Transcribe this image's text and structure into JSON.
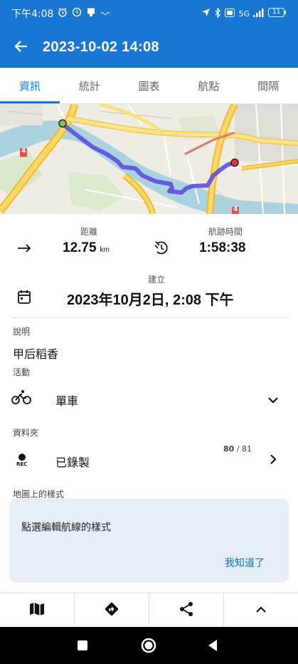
{
  "status_bar": {
    "time": "下午4:08",
    "right_text": "5G",
    "battery": "11"
  },
  "app_bar": {
    "title": "2023-10-02 14:08"
  },
  "tabs": [
    {
      "label": "資訊",
      "active": true
    },
    {
      "label": "統計",
      "active": false
    },
    {
      "label": "圖表",
      "active": false
    },
    {
      "label": "航點",
      "active": false
    },
    {
      "label": "間隔",
      "active": false
    }
  ],
  "stats": {
    "distance_label": "距離",
    "distance_value": "12.75",
    "distance_unit": "km",
    "time_label": "航跡時間",
    "time_value": "1:58:38",
    "created_label": "建立",
    "created_value": "2023年10月2日, 2:08 下午"
  },
  "description": {
    "label": "說明",
    "value": "甲后稻香"
  },
  "activity": {
    "label": "活動",
    "value": "單車"
  },
  "folder": {
    "label": "資料夾",
    "rec_text": "REC",
    "value": "已錄製",
    "count_current": "80",
    "count_separator": " / ",
    "count_total": "81"
  },
  "map_style": {
    "label": "地圖上的樣式",
    "tip_text": "點選編輯航線的樣式",
    "tip_button": "我知道了"
  },
  "map_labels": {
    "road_marker_left": "4",
    "road_marker_right": "4"
  },
  "colors": {
    "primary": "#1976d2",
    "track": "#5b4fe0",
    "tip_bg": "#e6eff7"
  },
  "icons": {
    "bottom_bar": [
      "map-icon",
      "directions-icon",
      "share-icon",
      "chevron-up-icon"
    ]
  }
}
